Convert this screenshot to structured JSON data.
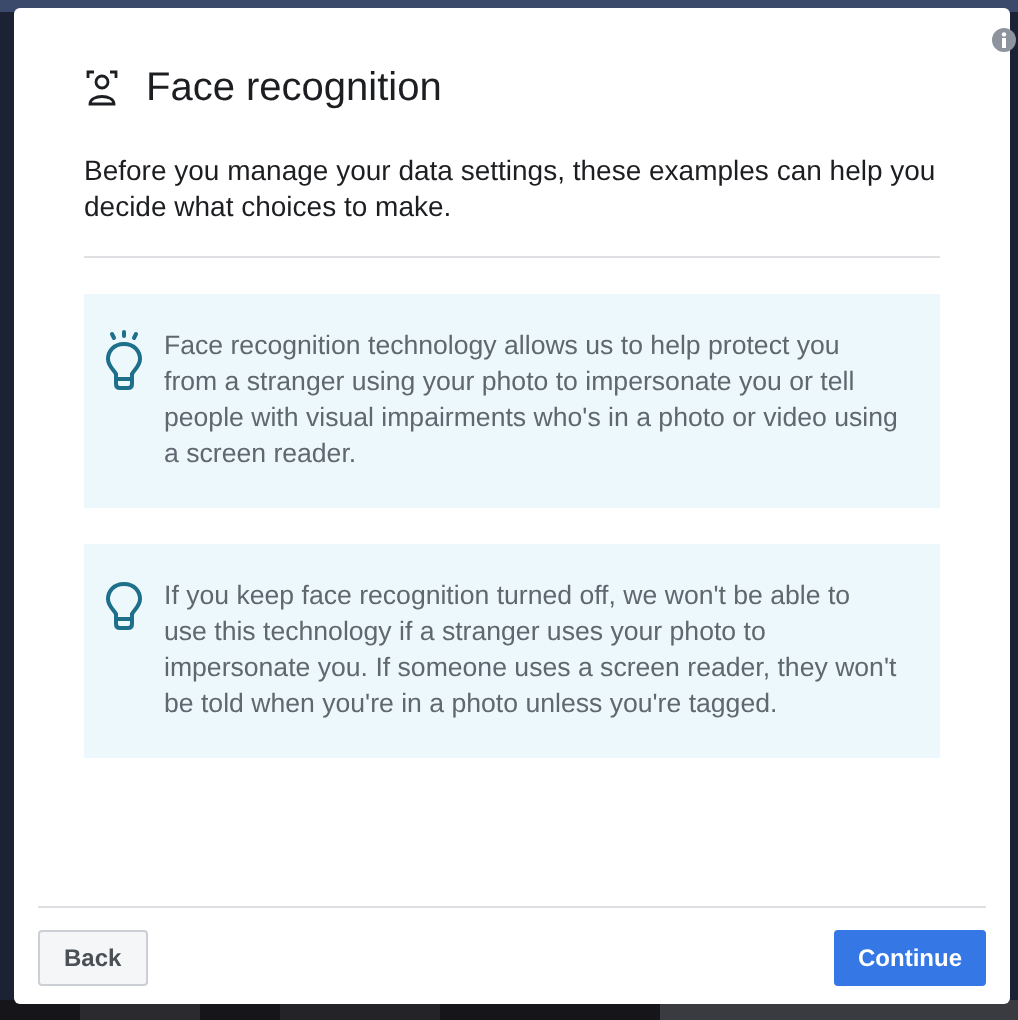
{
  "dialog": {
    "title": "Face recognition",
    "intro": "Before you manage your data settings, these examples can help you decide what choices to make.",
    "tips": [
      {
        "text": "Face recognition technology allows us to help protect you from a stranger using your photo to impersonate you or tell people with visual impairments who's in a photo or video using a screen reader.",
        "lit": true
      },
      {
        "text": "If you keep face recognition turned off, we won't be able to use this technology if a stranger uses your photo to impersonate you. If someone uses a screen reader, they won't be told when you're in a photo unless you're tagged.",
        "lit": false
      }
    ],
    "buttons": [
      {
        "label": "Back",
        "kind": "secondary"
      },
      {
        "label": "Continue",
        "kind": "primary"
      }
    ]
  }
}
